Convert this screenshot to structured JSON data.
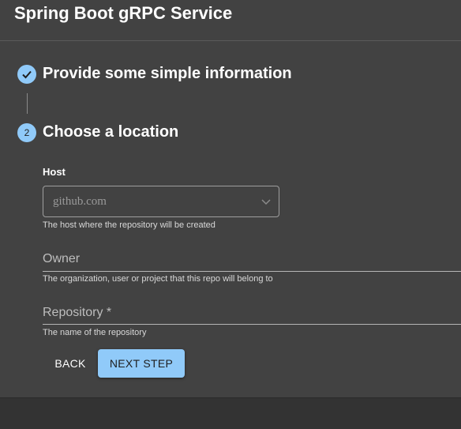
{
  "header": {
    "title": "Spring Boot gRPC Service"
  },
  "stepper": {
    "steps": [
      {
        "label": "Provide some simple information",
        "status": "completed",
        "icon": "check-icon"
      },
      {
        "number": "2",
        "label": "Choose a location",
        "status": "active"
      }
    ]
  },
  "form": {
    "host": {
      "label": "Host",
      "value": "github.com",
      "helper": "The host where the repository will be created"
    },
    "owner": {
      "label": "Owner",
      "helper": "The organization, user or project that this repo will belong to"
    },
    "repository": {
      "label": "Repository *",
      "helper": "The name of the repository"
    }
  },
  "actions": {
    "back_label": "BACK",
    "next_label": "NEXT STEP"
  },
  "colors": {
    "accent": "#90caf9",
    "background": "#424242"
  }
}
